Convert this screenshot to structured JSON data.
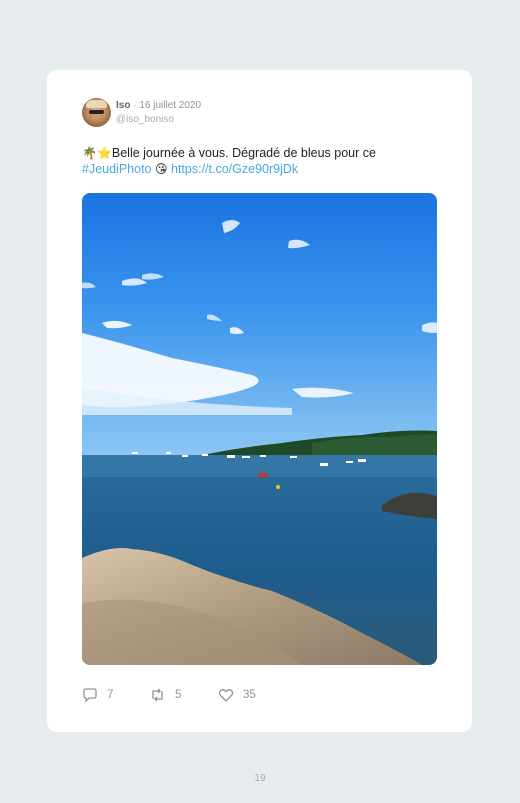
{
  "tweet": {
    "author_name": "Iso",
    "date": "· 16 juillet 2020",
    "handle": "@iso_boniso",
    "text_emoji_prefix": "🌴⭐",
    "text_main": "Belle journée à vous. Dégradé de bleus pour ce",
    "hashtag": "#JeudiPhoto",
    "text_emoji_mid": "😘",
    "link": "https://t.co/Gze90r9jDk",
    "photo_alt": "photo"
  },
  "actions": {
    "replies": "7",
    "retweets": "5",
    "likes": "35"
  },
  "page_number": "19",
  "colors": {
    "background": "#e6ecee",
    "card": "#ffffff",
    "link": "#4aa8e0",
    "muted": "#8a949a"
  },
  "icons": [
    "reply-icon",
    "retweet-icon",
    "heart-icon"
  ]
}
